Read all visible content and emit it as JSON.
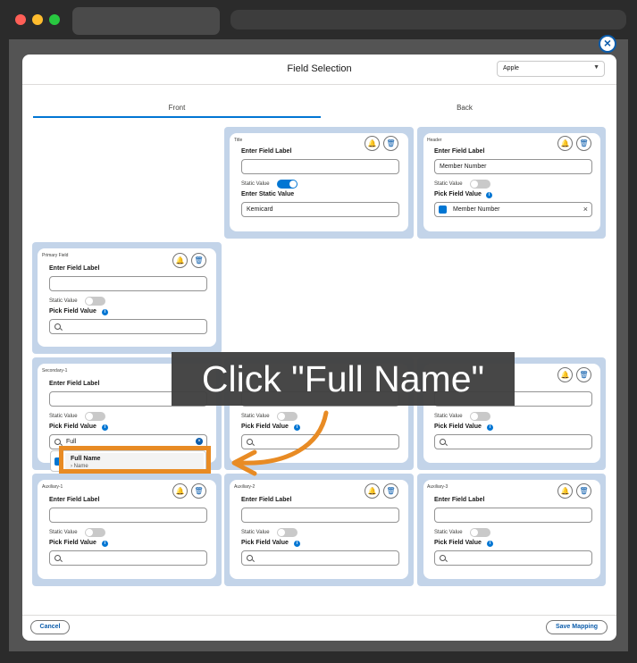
{
  "modal": {
    "title": "Field Selection",
    "select_value": "Apple",
    "close_icon": "close-icon"
  },
  "tabs": [
    "Front",
    "Back"
  ],
  "common": {
    "enter_field_label": "Enter Field Label",
    "static_value": "Static Value",
    "pick_field_value": "Pick Field Value",
    "enter_static_value": "Enter Static Value",
    "info": "i"
  },
  "cards": {
    "title": {
      "name": "Title",
      "static_on": true,
      "static_value": "Kemicard"
    },
    "header": {
      "name": "Header",
      "label_value": "Member Number",
      "pick_value": "Member Number",
      "static_on": false
    },
    "primary": {
      "name": "Primary Field"
    },
    "secondary1": {
      "name": "Secondary-1",
      "search_value": "Full"
    },
    "auxiliary1": {
      "name": "Auxiliary-1"
    },
    "auxiliary2": {
      "name": "Auxiliary-2"
    },
    "auxiliary3": {
      "name": "Auxiliary-3"
    }
  },
  "dropdown": {
    "option_title": "Full Name",
    "option_sub": "› Name"
  },
  "callout": "Click \"Full Name\"",
  "footer": {
    "cancel": "Cancel",
    "save": "Save Mapping"
  },
  "colors": {
    "accent": "#0176d3",
    "highlight": "#e88b24",
    "slot_bg": "#c3d4e9"
  }
}
